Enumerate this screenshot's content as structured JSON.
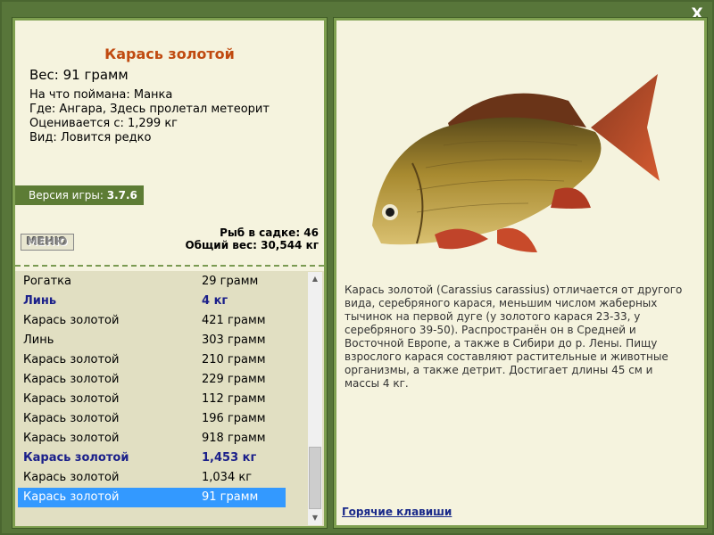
{
  "window": {
    "close_label": "X"
  },
  "fish": {
    "title": "Карась золотой",
    "weight": "Вес: 91 грамм",
    "caught_with": "На что поймана: Манка",
    "location": "Где: Ангара, Здесь пролетал метеорит",
    "valued_from": "Оценивается с: 1,299 кг",
    "rarity": "Вид: Ловится редко"
  },
  "version": {
    "label": "Версия игры:",
    "number": "3.7.6"
  },
  "menu": {
    "label": "МЕНЮ"
  },
  "stats": {
    "fish_count": "Рыб в садке: 46",
    "total_weight": "Общий вес: 30,544 кг"
  },
  "catch_list": [
    {
      "name": "Рогатка",
      "weight": "29 грамм",
      "bold": false,
      "selected": false
    },
    {
      "name": "Линь",
      "weight": "4 кг",
      "bold": true,
      "selected": false
    },
    {
      "name": "Карась золотой",
      "weight": "421 грамм",
      "bold": false,
      "selected": false
    },
    {
      "name": "Линь",
      "weight": "303 грамм",
      "bold": false,
      "selected": false
    },
    {
      "name": "Карась золотой",
      "weight": "210 грамм",
      "bold": false,
      "selected": false
    },
    {
      "name": "Карась золотой",
      "weight": "229 грамм",
      "bold": false,
      "selected": false
    },
    {
      "name": "Карась золотой",
      "weight": "112 грамм",
      "bold": false,
      "selected": false
    },
    {
      "name": "Карась золотой",
      "weight": "196 грамм",
      "bold": false,
      "selected": false
    },
    {
      "name": "Карась золотой",
      "weight": "918 грамм",
      "bold": false,
      "selected": false
    },
    {
      "name": "Карась золотой",
      "weight": "1,453 кг",
      "bold": true,
      "selected": false
    },
    {
      "name": "Карась золотой",
      "weight": "1,034 кг",
      "bold": false,
      "selected": false
    },
    {
      "name": "Карась золотой",
      "weight": "91 грамм",
      "bold": false,
      "selected": true
    }
  ],
  "description": "Карась золотой (Carassius carassius) отличается от другого вида, серебряного карася, меньшим числом жаберных тычинок на первой дуге (у золотого карася 23-33, у серебряного 39-50). Распространён он в Средней и Восточной Европе, а также в Сибири до р. Лены. Пищу взрослого карася составляют растительные и животные организмы, а также детрит. Достигает длины 45 см и массы 4 кг.",
  "hotkeys_label": "Горячие клавиши",
  "colors": {
    "frame": "#58763a",
    "panel": "#f5f3de",
    "title": "#c04a10",
    "highlight": "#3399ff",
    "bold_entry": "#1a1f8a"
  },
  "icons": {
    "close": "close-icon",
    "scroll_up": "scroll-up-arrow-icon",
    "scroll_down": "scroll-down-arrow-icon"
  }
}
